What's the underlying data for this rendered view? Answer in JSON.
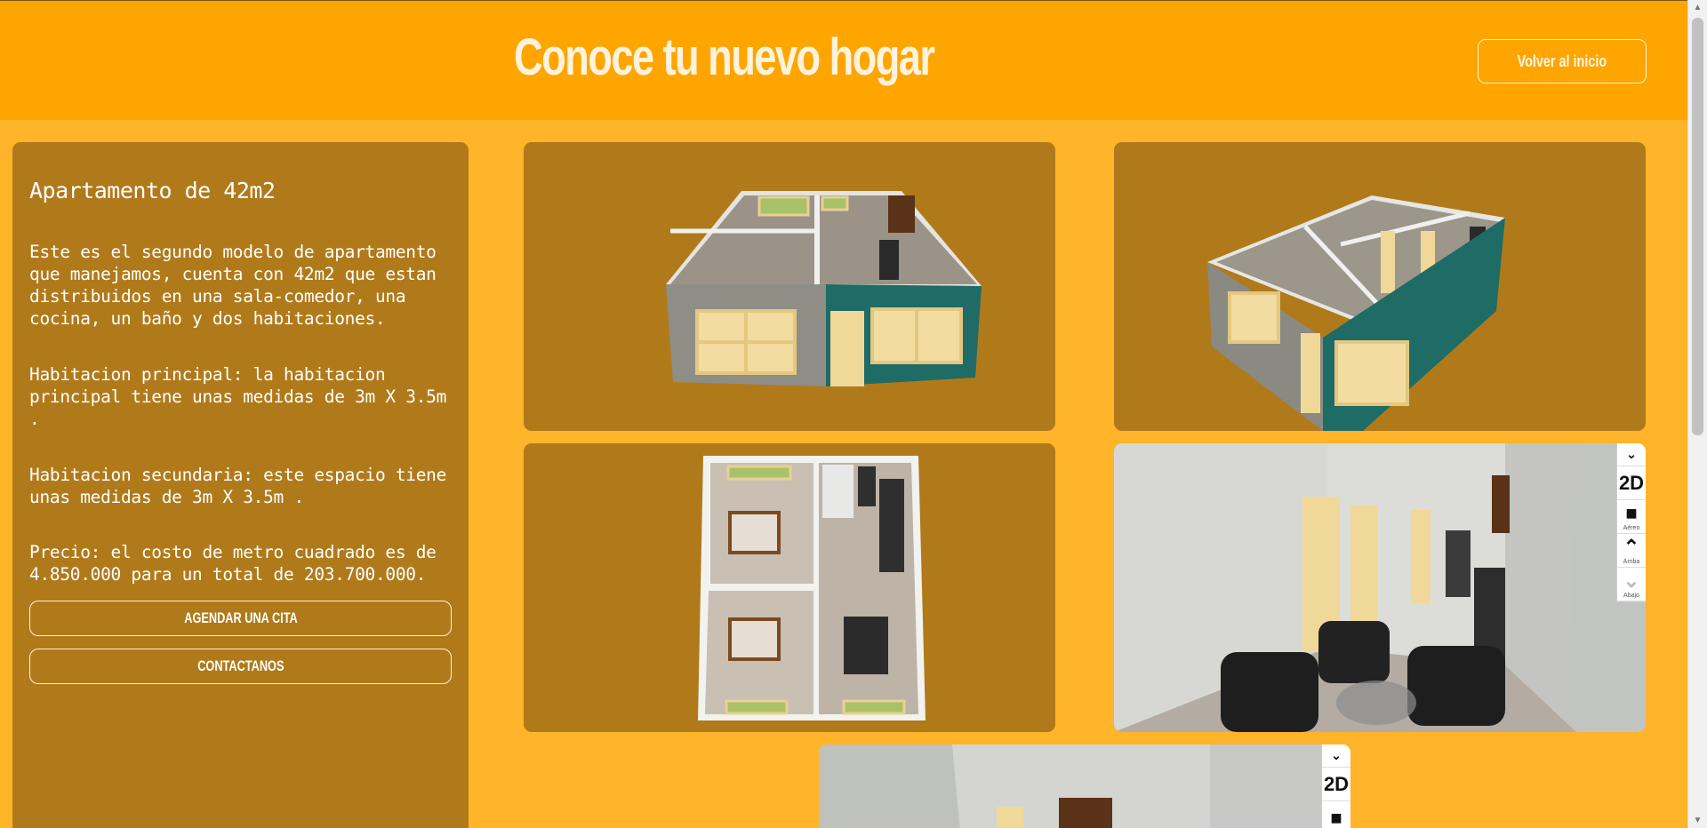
{
  "header": {
    "title": "Conoce tu nuevo hogar",
    "home_button": "Volver al inicio"
  },
  "info": {
    "title": "Apartamento de 42m2",
    "description": "Este es el segundo modelo de apartamento que manejamos, cuenta con 42m2 que estan distribuidos en una sala-comedor, una cocina, un baño y dos habitaciones.",
    "main_room": "Habitacion principal: la habitacion principal tiene unas medidas de 3m X 3.5m .",
    "second_room": "Habitacion secundaria: este espacio tiene unas medidas de 3m X 3.5m .",
    "price": "Precio: el costo de metro cuadrado es de 4.850.000 para un total de 203.700.000.",
    "schedule_button": "AGENDAR UNA CITA",
    "contact_button": "CONTACTANOS"
  },
  "viewer_controls": {
    "toggle_icon": "chevron-down-icon",
    "mode_label": "2D",
    "camera_label": "Aéreo",
    "up_label": "Arriba",
    "down_label": "Abajo"
  },
  "colors": {
    "header_bg": "#ffa500",
    "page_bg": "#ffb429",
    "panel_bg": "#b07a1b",
    "wall_teal": "#1f6b66"
  }
}
